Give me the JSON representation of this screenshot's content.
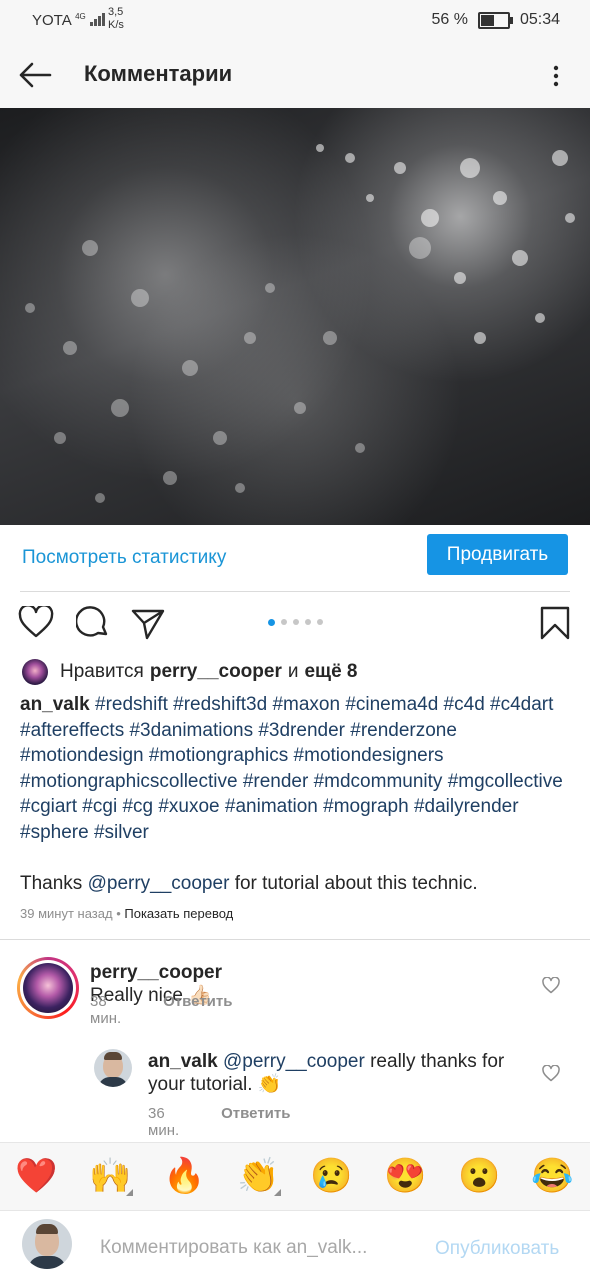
{
  "status_bar": {
    "carrier": "YOTA",
    "network": "4G",
    "speed_value": "3,5",
    "speed_unit": "K/s",
    "battery": "56 %",
    "battery_level": 0.56,
    "time": "05:34"
  },
  "header": {
    "title": "Комментарии",
    "back_icon": "arrow-left-icon",
    "menu_icon": "kebab-menu-icon"
  },
  "post": {
    "image_description_icon": "photo",
    "stats_link": "Посмотреть статистику",
    "promote_button": "Продвигать",
    "carousel_pages": 5,
    "carousel_active": 1,
    "likes": {
      "prefix": "Нравится",
      "user": "perry__cooper",
      "conj": "и",
      "rest": "ещё 8"
    },
    "caption": {
      "user": "an_valk",
      "tags": "#redshift #redshift3d #maxon #cinema4d #c4d #c4dart #aftereffects #3danimations #3drender #renderzone #motiondesign #motiongraphics #motiondesigners #motiongraphicscollective #render #mdcommunity #mgcollective #cgiart #cgi #cg #xuxoe #animation #mograph #dailyrender #sphere #silver",
      "thanks_prefix": "Thanks",
      "thanks_mention": "@perry__cooper",
      "thanks_suffix": "for tutorial about this technic."
    },
    "time_ago": "39 минут назад",
    "separator": "•",
    "translate": "Показать перевод"
  },
  "comments": [
    {
      "user": "perry__cooper",
      "text": "Really nice 👍🏻",
      "time": "38 мин.",
      "reply": "Ответить"
    },
    {
      "user": "an_valk",
      "mention": "@perry__cooper",
      "text": "really thanks for your tutorial. 👏",
      "time": "36 мин.",
      "reply": "Ответить"
    }
  ],
  "emoji_bar": [
    "❤️",
    "🙌",
    "🔥",
    "👏",
    "😢",
    "😍",
    "😮",
    "😂"
  ],
  "composer": {
    "placeholder": "Комментировать как an_valk...",
    "post_button": "Опубликовать"
  },
  "colors": {
    "link_blue": "#1a95d6",
    "button_blue": "#1694e4",
    "hashtag": "#1f3f63"
  }
}
